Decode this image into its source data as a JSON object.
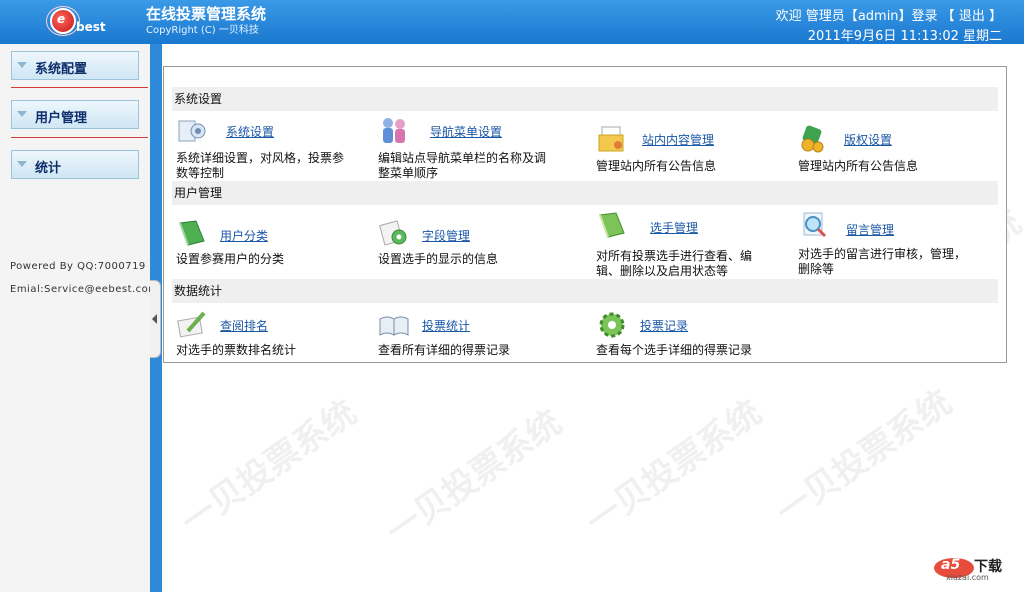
{
  "header": {
    "logo_text": "best",
    "logo_letter": "e",
    "title": "在线投票管理系统",
    "copyright": "CopyRight (C) 一贝科技",
    "welcome_prefix": "欢迎 管理员【",
    "user": "admin",
    "login_suffix": "】登录 【",
    "logout_label": "退出",
    "logout_suffix": "】",
    "datetime": "2011年9月6日 11:13:02 星期二"
  },
  "sidebar": {
    "items": [
      {
        "label": "系统配置"
      },
      {
        "label": "用户管理"
      },
      {
        "label": "统计"
      }
    ],
    "powered_by": "Powered By QQ:7000719",
    "email": "Emial:Service@eebest.com"
  },
  "sections": [
    {
      "title": "系统设置",
      "items": [
        {
          "title": "系统设置",
          "desc": "系统详细设置，对风格，投票参数等控制",
          "icon": "settings-icon"
        },
        {
          "title": "导航菜单设置",
          "desc": "编辑站点导航菜单栏的名称及调整菜单顺序",
          "icon": "users-icon"
        },
        {
          "title": "站内内容管理",
          "desc": "管理站内所有公告信息",
          "icon": "folder-icon"
        },
        {
          "title": "版权设置",
          "desc": "管理站内所有公告信息",
          "icon": "medal-icon"
        }
      ]
    },
    {
      "title": "用户管理",
      "items": [
        {
          "title": "用户分类",
          "desc": "设置参赛用户的分类",
          "icon": "book-green-icon"
        },
        {
          "title": "字段管理",
          "desc": "设置选手的显示的信息",
          "icon": "gear-paper-icon"
        },
        {
          "title": "选手管理",
          "desc": "对所有投票选手进行查看、编辑、删除以及启用状态等",
          "icon": "book-green-icon"
        },
        {
          "title": "留言管理",
          "desc": "对选手的留言进行审核，管理，删除等",
          "icon": "magnifier-icon"
        }
      ]
    },
    {
      "title": "数据统计",
      "items": [
        {
          "title": "查阅排名",
          "desc": "对选手的票数排名统计",
          "icon": "pencil-paper-icon"
        },
        {
          "title": "投票统计",
          "desc": "查看所有详细的得票记录",
          "icon": "open-book-icon"
        },
        {
          "title": "投票记录",
          "desc": "查看每个选手详细的得票记录",
          "icon": "green-gear-icon"
        }
      ]
    }
  ],
  "watermark": "一贝投票系统",
  "badge": {
    "brand": "a5",
    "label": "下载",
    "site": "xiazai.com"
  },
  "colors": {
    "header": "#2284d9",
    "link": "#1a57a6",
    "accent": "#c3141a"
  }
}
